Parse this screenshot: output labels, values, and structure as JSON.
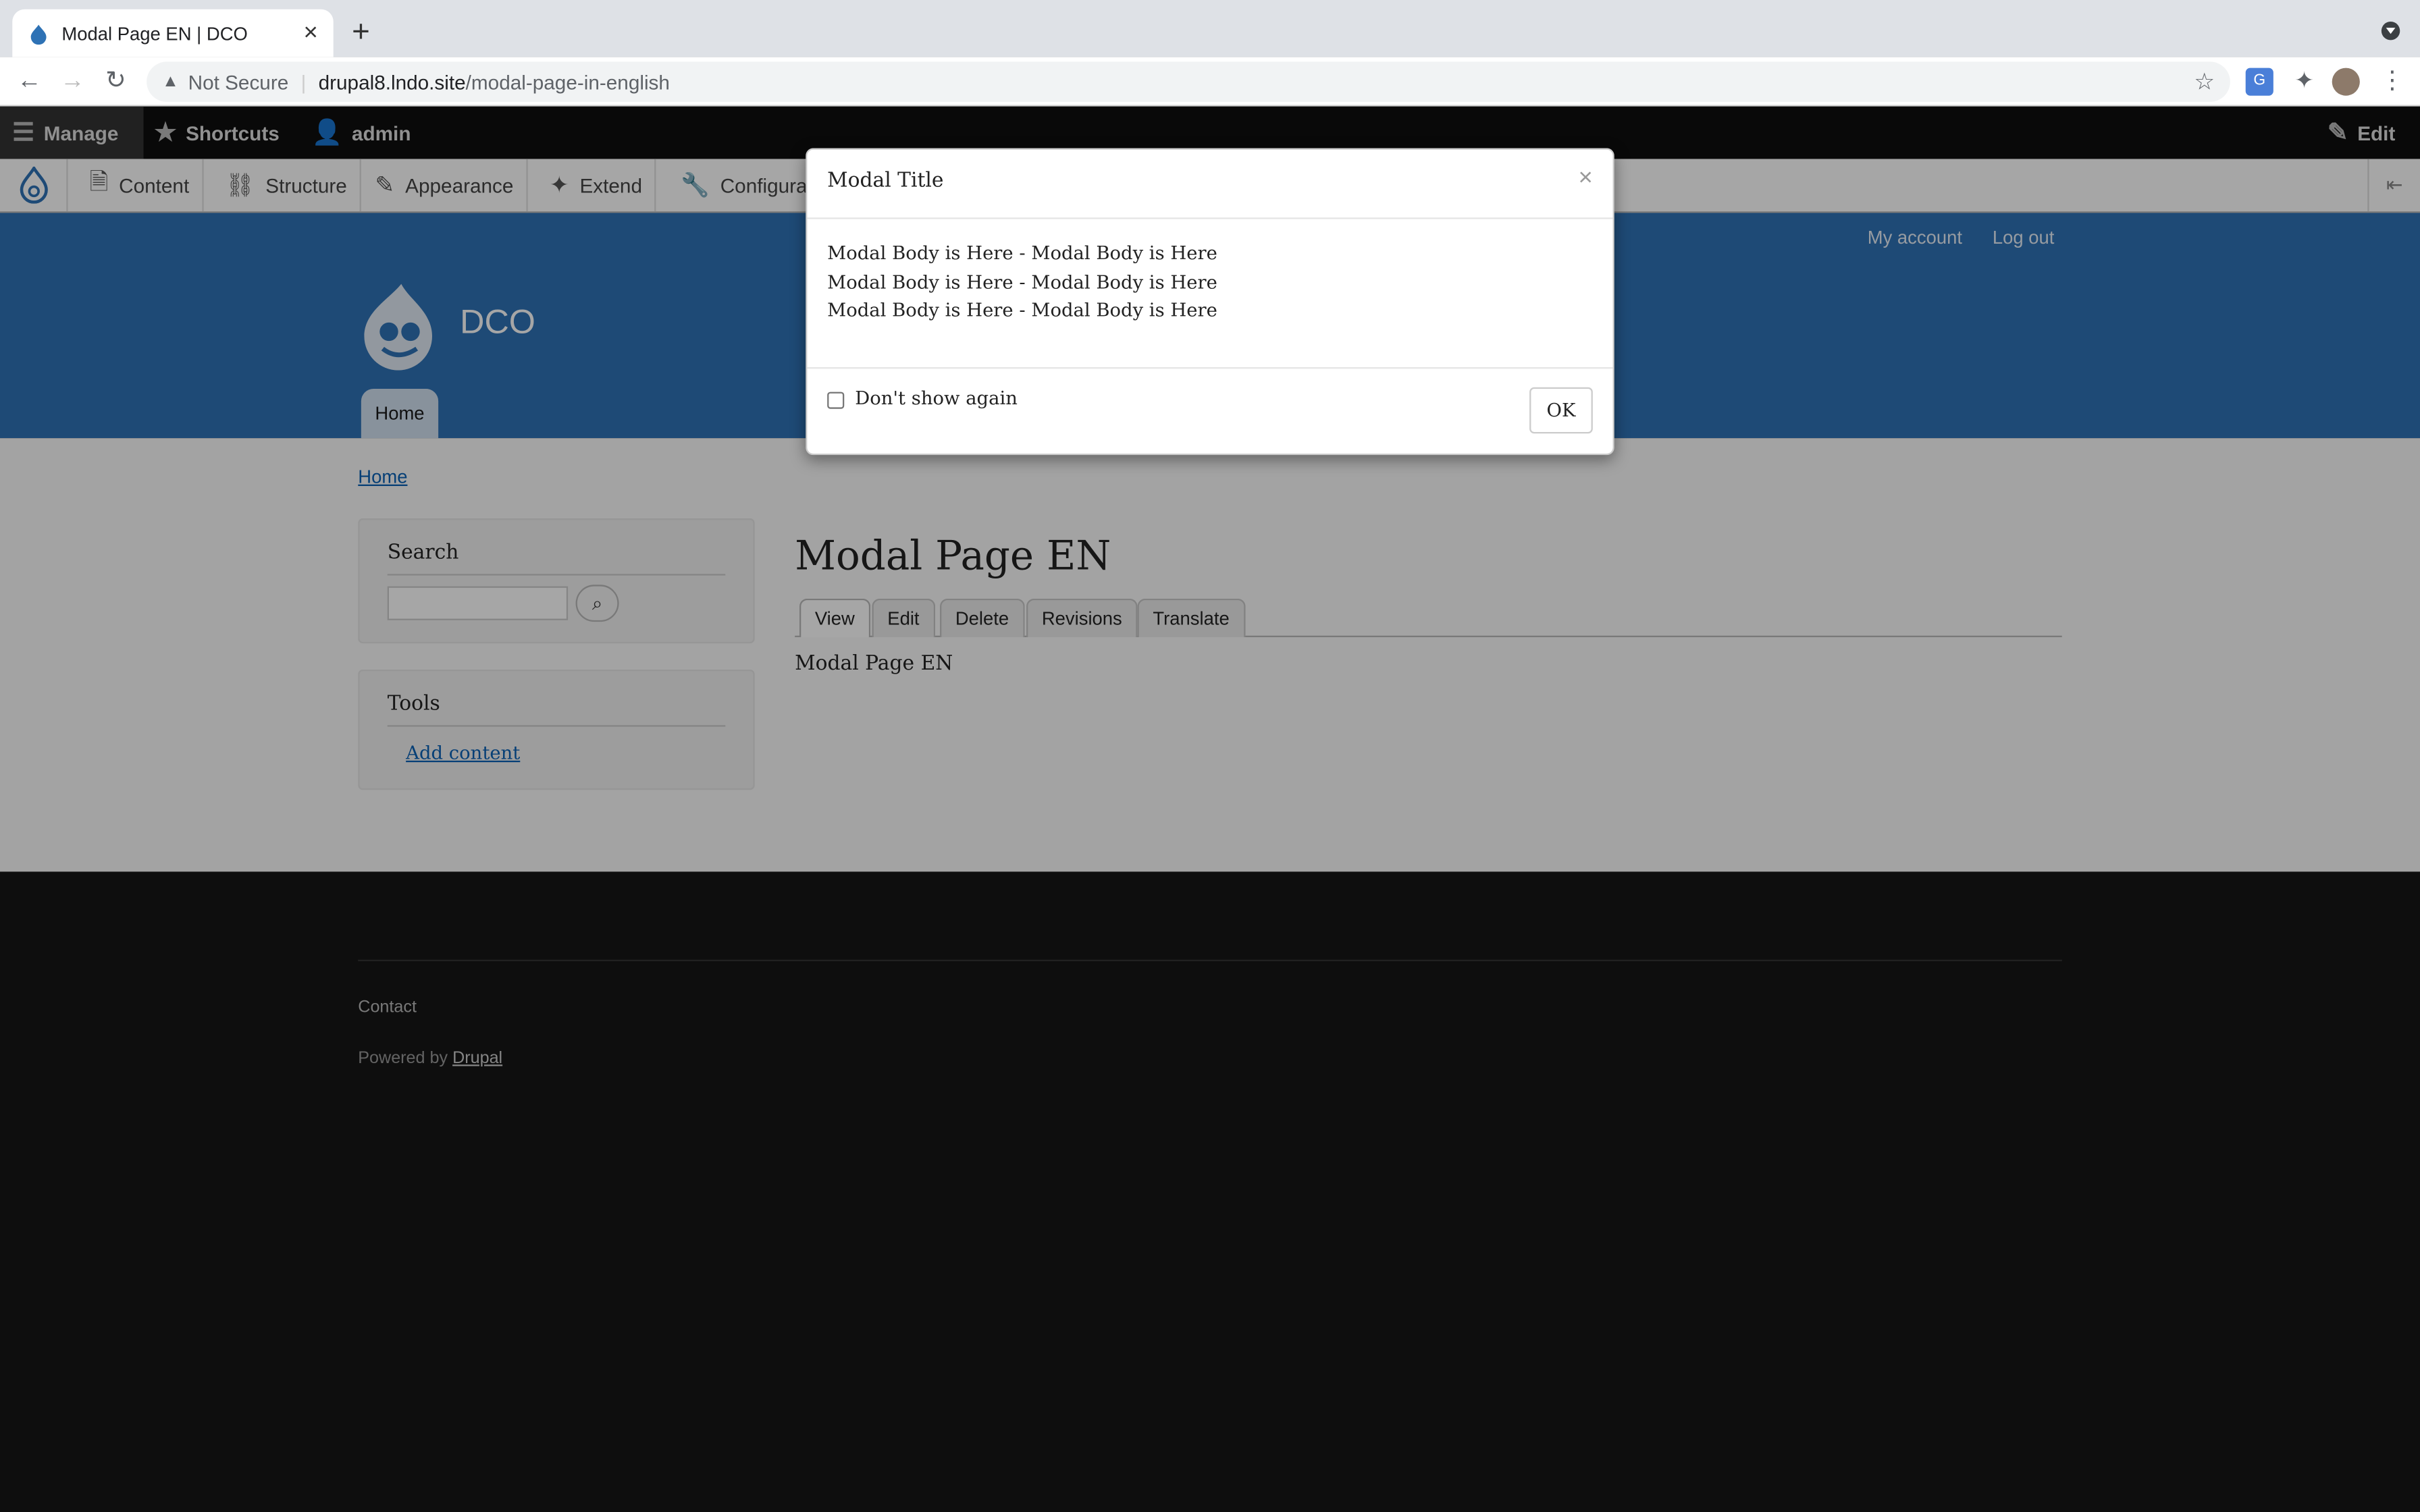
{
  "browser": {
    "tab_title": "Modal Page EN | DCO",
    "security_label": "Not Secure",
    "url_host": "drupal8.lndo.site",
    "url_path": "/modal-page-in-english"
  },
  "admin_toolbar": {
    "manage": "Manage",
    "shortcuts": "Shortcuts",
    "user": "admin",
    "edit": "Edit",
    "menu": [
      "Content",
      "Structure",
      "Appearance",
      "Extend",
      "Configurat"
    ]
  },
  "site": {
    "name": "DCO",
    "account": "My account",
    "logout": "Log out",
    "main_nav_home": "Home"
  },
  "page": {
    "breadcrumb": "Home",
    "search_title": "Search",
    "tools_title": "Tools",
    "add_content": "Add content",
    "title": "Modal Page EN",
    "tabs": [
      "View",
      "Edit",
      "Delete",
      "Revisions",
      "Translate"
    ],
    "body": "Modal Page EN"
  },
  "footer": {
    "contact": "Contact",
    "powered_prefix": "Powered by",
    "powered_link": "Drupal"
  },
  "modal": {
    "title": "Modal Title",
    "close": "×",
    "body_lines": [
      "Modal Body is Here - Modal Body is Here",
      "Modal Body is Here - Modal Body is Here",
      "Modal Body is Here - Modal Body is Here"
    ],
    "dont_show_label": "Don't show again",
    "dont_show_checked": false,
    "ok": "OK"
  },
  "colors": {
    "header_blue": "#2e72b5",
    "link_blue": "#0a62b5",
    "footer_dark": "#161616"
  }
}
